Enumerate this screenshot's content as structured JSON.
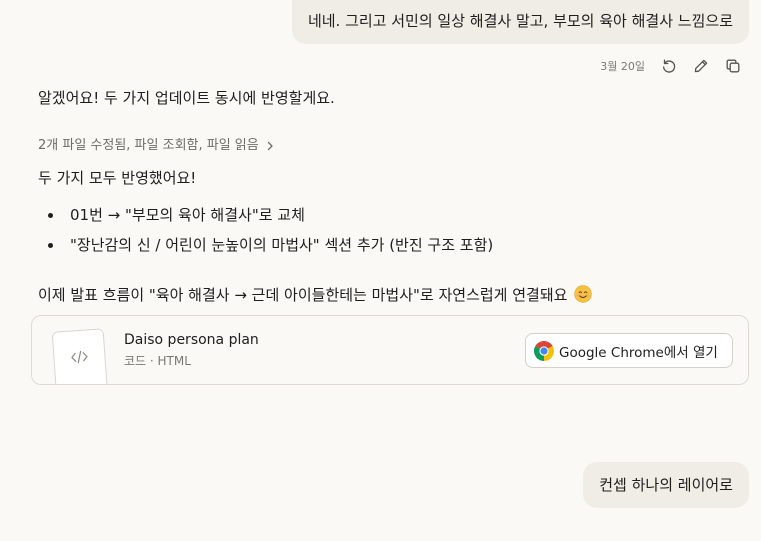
{
  "conversation": {
    "user_message_1": "네네. 그리고 서민의 일상 해결사 말고, 부모의 육아 해결사 느낌으로",
    "message_meta": {
      "date": "3월 20일",
      "icons": [
        "retry-icon",
        "edit-icon",
        "copy-icon"
      ]
    },
    "assistant": {
      "intro": "알겠어요! 두 가지 업데이트 동시에 반영할게요.",
      "tool_summary": "2개 파일 수정됨, 파일 조회함, 파일 읽음",
      "done_text": "두 가지 모두 반영했어요!",
      "bullets": [
        "01번 → \"부모의 육아 해결사\"로 교체",
        "\"장난감의 신 / 어린이 눈높이의 마법사\" 섹션 추가 (반진 구조 포함)"
      ],
      "summary": "이제 발표 흐름이 \"육아 해결사 → 근데 아이들한테는 마법사\"로 자연스럽게 연결돼요",
      "summary_emoji": "smiling-face-emoji"
    },
    "artifact": {
      "title": "Daiso persona plan",
      "subtitle": "코드 · HTML",
      "thumb_icon": "code-icon",
      "open_button": {
        "icon": "chrome-icon",
        "label": "Google Chrome에서 열기"
      }
    },
    "user_message_2": "컨셉 하나의 레이어로"
  },
  "colors": {
    "background": "#faf9f5",
    "user_bubble": "#efede6",
    "card_border": "#dedbd2",
    "muted_text": "#7a7873"
  }
}
